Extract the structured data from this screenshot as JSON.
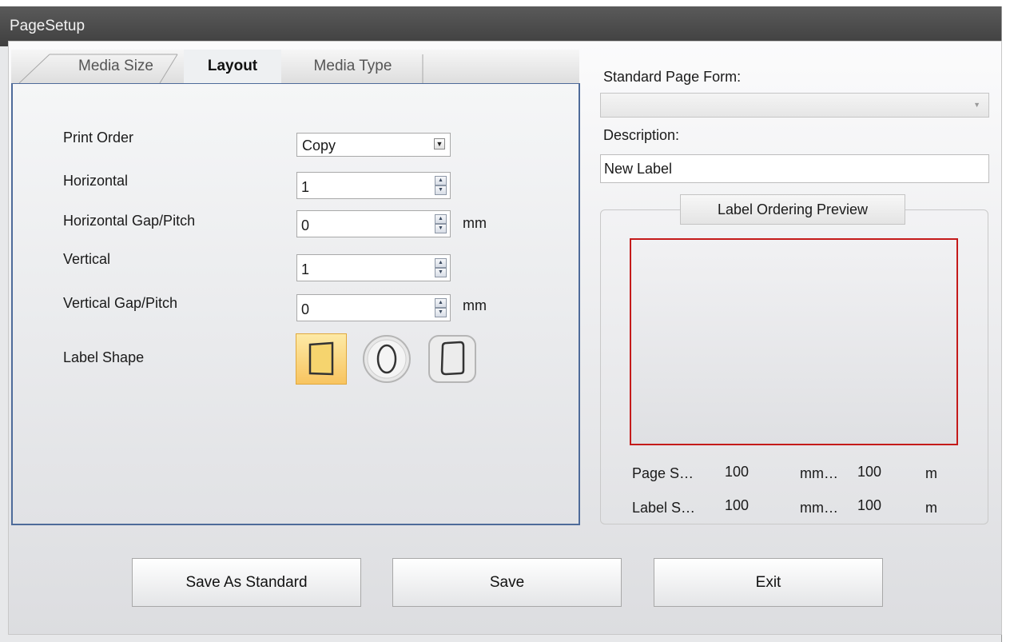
{
  "window": {
    "title": "PageSetup"
  },
  "tabs": [
    {
      "label": "Media Size"
    },
    {
      "label": "Layout"
    },
    {
      "label": "Media Type"
    }
  ],
  "layout": {
    "print_order": {
      "label": "Print Order",
      "value": "Copy"
    },
    "horizontal": {
      "label": "Horizontal",
      "value": "1"
    },
    "horizontal_gap": {
      "label": "Horizontal Gap/Pitch",
      "value": "0",
      "unit": "mm"
    },
    "vertical": {
      "label": "Vertical",
      "value": "1"
    },
    "vertical_gap": {
      "label": "Vertical Gap/Pitch",
      "value": "0",
      "unit": "mm"
    },
    "label_shape": {
      "label": "Label Shape",
      "selected": "rectangle",
      "options": [
        "rectangle",
        "ellipse",
        "rounded-rectangle"
      ]
    }
  },
  "standard_form": {
    "label": "Standard Page Form:",
    "value": ""
  },
  "description": {
    "label": "Description:",
    "value": "New Label"
  },
  "preview": {
    "title": "Label Ordering Preview",
    "border_color": "#c41a1a",
    "page_size": {
      "label": "Page S…",
      "width": "100",
      "unit1": "mm…",
      "height": "100",
      "unit2": "m"
    },
    "label_size": {
      "label": "Label S…",
      "width": "100",
      "unit1": "mm…",
      "height": "100",
      "unit2": "m"
    }
  },
  "buttons": {
    "save_as_standard": "Save As Standard",
    "save": "Save",
    "exit": "Exit"
  },
  "colors": {
    "titlebar": "#4a4a4a",
    "tab_border": "#4e6b9a",
    "selected_shape": "#f8c460"
  }
}
